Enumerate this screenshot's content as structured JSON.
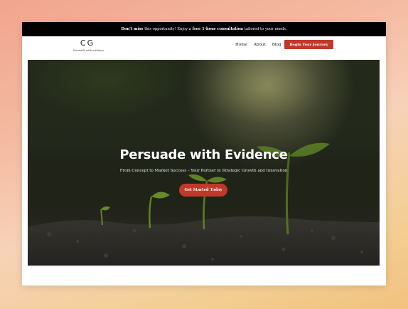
{
  "promo": {
    "part1": "Don't miss",
    "part2": "this opportunity! Enjoy a",
    "part3": "free 1-hour consultation",
    "part4": "tailored to your needs."
  },
  "brand": {
    "logo": "CG",
    "tagline": "Persuade with evidence"
  },
  "nav": {
    "items": [
      "Home",
      "About",
      "Blog"
    ],
    "cta": "Begin Your Journey"
  },
  "hero": {
    "title": "Persuade with Evidence",
    "subtitle": "From Concept to Market Success – Your Partner in Strategic Growth and Innovation",
    "cta": "Get Started Today"
  },
  "colors": {
    "accent": "#c0392b",
    "promo_bg": "#000000",
    "page_bg_start": "#f1a58f",
    "page_bg_end": "#f2c27e"
  }
}
